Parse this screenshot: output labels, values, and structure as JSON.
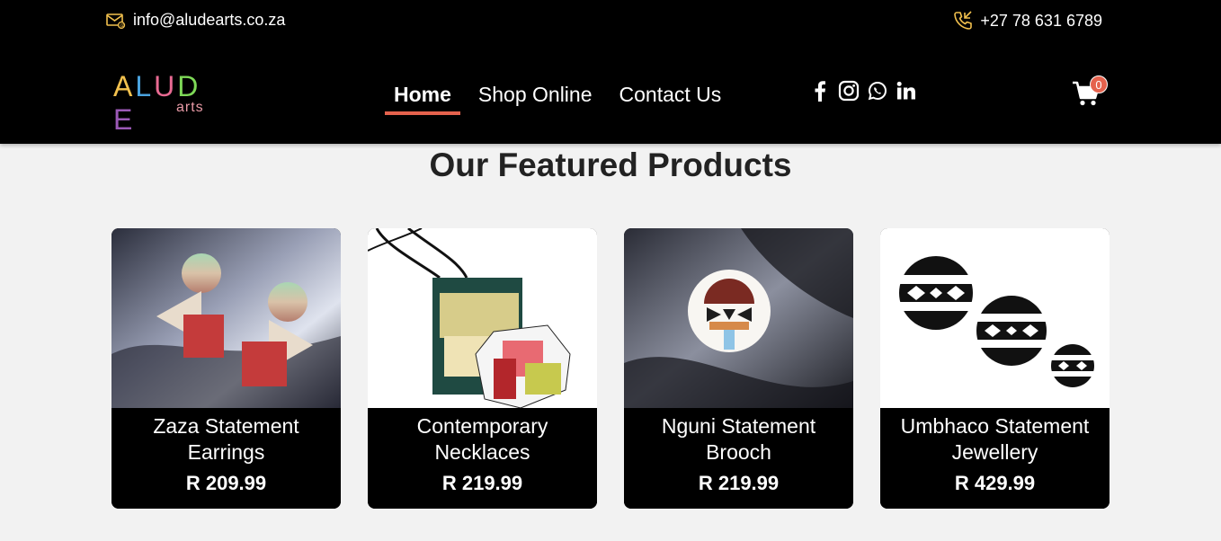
{
  "topbar": {
    "email": "info@aludearts.co.za",
    "email_icon": "envelope-icon",
    "phone": "+27 78 631 6789",
    "phone_icon": "phone-call-icon"
  },
  "logo": {
    "main": "ALUDE",
    "sub": "arts",
    "colors": [
      "#f2c14e",
      "#4aa3df",
      "#e86a92",
      "#7ed957",
      "#9b59b6"
    ]
  },
  "nav": {
    "items": [
      {
        "label": "Home",
        "active": true
      },
      {
        "label": "Shop Online",
        "active": false
      },
      {
        "label": "Contact Us",
        "active": false
      }
    ]
  },
  "social": [
    "facebook-icon",
    "instagram-icon",
    "whatsapp-icon",
    "linkedin-icon"
  ],
  "cart": {
    "count": "0",
    "icon": "shopping-cart-icon"
  },
  "featured": {
    "title": "Our Featured Products",
    "products": [
      {
        "name": "Zaza Statement Earrings",
        "price": "R 209.99"
      },
      {
        "name": "Contemporary Necklaces",
        "price": "R 219.99"
      },
      {
        "name": "Nguni Statement Brooch",
        "price": "R 219.99"
      },
      {
        "name": "Umbhaco Statement Jewellery",
        "price": "R 429.99"
      }
    ]
  },
  "colors": {
    "accent": "#e5624d",
    "header_bg": "#000000",
    "page_bg": "#f2f2f2"
  }
}
